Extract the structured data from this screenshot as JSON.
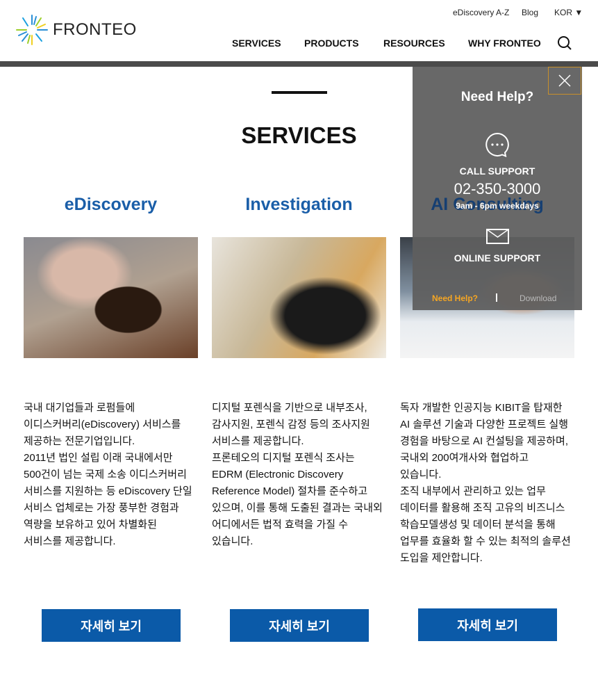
{
  "header": {
    "logo": "FRONTEO",
    "util": [
      "eDiscovery A-Z",
      "Blog",
      "KOR"
    ],
    "nav": [
      "SERVICES",
      "PRODUCTS",
      "RESOURCES",
      "WHY FRONTEO"
    ]
  },
  "main": {
    "title": "SERVICES",
    "columns": [
      {
        "heading": "eDiscovery",
        "lines": [
          "국내 대기업들과 로펌들에",
          "이디스커버리(eDiscovery) 서비스를",
          "제공하는 전문기업입니다.",
          "2011년 법인 설립 이래 국내에서만",
          "500건이 넘는 국제 소송 이디스커버리",
          "서비스를 지원하는 등 eDiscovery 단일",
          "서비스 업체로는 가장 풍부한 경험과",
          "역량을 보유하고 있어 차별화된",
          "서비스를 제공합니다."
        ],
        "button": "자세히 보기"
      },
      {
        "heading": "Investigation",
        "lines": [
          "디지털 포렌식을 기반으로 내부조사,",
          "감사지원, 포렌식 감정 등의 조사지원",
          "서비스를 제공합니다.",
          "프론테오의 디지털 포렌식 조사는",
          "EDRM (Electronic Discovery",
          "Reference Model) 절차를 준수하고",
          "있으며, 이를 통해 도출된 결과는 국내외",
          "어디에서든 법적 효력을 가질 수",
          "있습니다."
        ],
        "button": "자세히 보기"
      },
      {
        "heading": "AI Consulting",
        "lines": [
          "독자 개발한 인공지능 KIBIT을 탑재한",
          "AI 솔루션 기술과 다양한 프로젝트 실행",
          "경험을 바탕으로 AI 컨설팅을 제공하며,",
          "국내외 200여개사와 협업하고",
          "있습니다.",
          "조직 내부에서 관리하고 있는 업무",
          "데이터를 활용해 조직 고유의 비즈니스",
          "학습모델생성 및 데이터 분석을 통해",
          "업무를 효율화 할 수 있는 최적의 솔루션",
          "도입을 제안합니다."
        ],
        "button": "자세히 보기"
      }
    ]
  },
  "help": {
    "title": "Need Help?",
    "call": "CALL SUPPORT",
    "phone": "02-350-3000",
    "hours": "9am - 6pm weekdays",
    "online": "ONLINE SUPPORT",
    "tab_help": "Need Help?",
    "tab_download": "Download",
    "accent": "#f5a623"
  }
}
